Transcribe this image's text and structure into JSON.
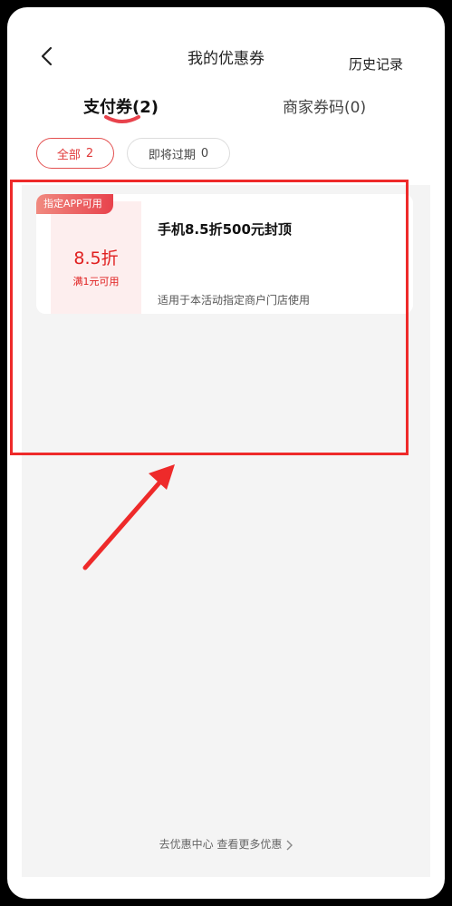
{
  "header": {
    "title": "我的优惠券",
    "history_label": "历史记录"
  },
  "tabs": [
    {
      "label": "支付券(2)",
      "active": true
    },
    {
      "label": "商家券码(0)",
      "active": false
    }
  ],
  "filters": [
    {
      "label": "全部",
      "count": "2",
      "active": true
    },
    {
      "label": "即将过期",
      "count": "0",
      "active": false
    }
  ],
  "coupons": [
    {
      "tag": "指定APP可用",
      "discount": "8.5折",
      "threshold": "满1元可用",
      "title": "手机8.5折500元封顶",
      "description": "适用于本活动指定商户门店使用"
    }
  ],
  "footer": {
    "link_text": "去优惠中心 查看更多优惠"
  },
  "colors": {
    "accent": "#e02020",
    "annotation": "#ee2a2a",
    "list_background": "#f4f4f4"
  },
  "icons": {
    "back": "chevron-left-icon",
    "footer": "chevron-right-icon"
  }
}
